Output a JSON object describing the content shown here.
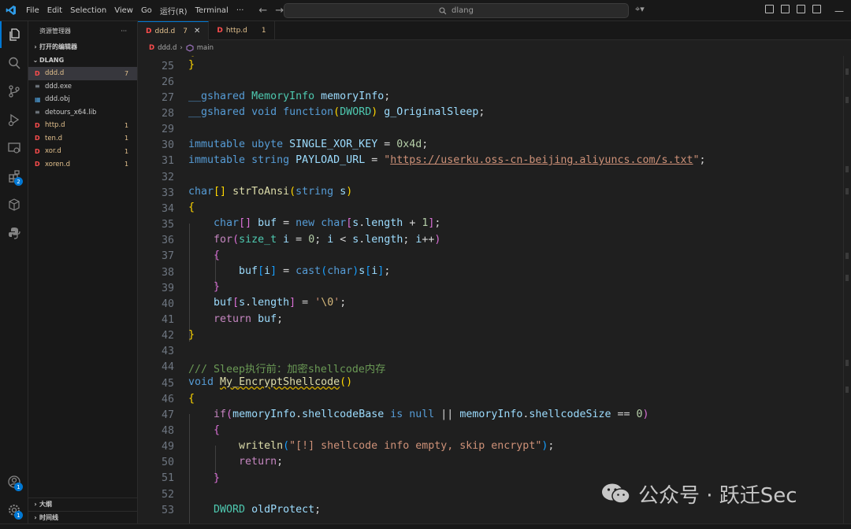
{
  "titlebar": {
    "menu": [
      "File",
      "Edit",
      "Selection",
      "View",
      "Go",
      "运行(R)",
      "Terminal",
      "···"
    ],
    "search_text": "dlang"
  },
  "activity_badges": {
    "extensions": "2",
    "accounts": "1",
    "settings": "1"
  },
  "sidebar": {
    "title": "资源管理器",
    "more": "···",
    "open_editors_label": "打开的编辑器",
    "folder_label": "DLANG",
    "files": [
      {
        "icon": "D",
        "name": "ddd.d",
        "count": "7",
        "modified": true,
        "selected": true
      },
      {
        "icon": "≡",
        "name": "ddd.exe",
        "count": "",
        "modified": false,
        "selected": false
      },
      {
        "icon": "▦",
        "name": "ddd.obj",
        "count": "",
        "modified": false,
        "selected": false
      },
      {
        "icon": "≡",
        "name": "detours_x64.lib",
        "count": "",
        "modified": false,
        "selected": false
      },
      {
        "icon": "D",
        "name": "http.d",
        "count": "1",
        "modified": true,
        "selected": false
      },
      {
        "icon": "D",
        "name": "ten.d",
        "count": "1",
        "modified": true,
        "selected": false
      },
      {
        "icon": "D",
        "name": "xor.d",
        "count": "1",
        "modified": true,
        "selected": false
      },
      {
        "icon": "D",
        "name": "xoren.d",
        "count": "1",
        "modified": true,
        "selected": false
      }
    ],
    "outline_label": "大纲",
    "timeline_label": "时间线"
  },
  "tabs": [
    {
      "icon": "D",
      "name": "ddd.d",
      "count": "7",
      "close": "✕",
      "active": true
    },
    {
      "icon": "D",
      "name": "http.d",
      "count": "1",
      "close": "",
      "active": false
    }
  ],
  "breadcrumb": {
    "file_icon": "D",
    "file": "ddd.d",
    "sep": "›",
    "symbol": "main"
  },
  "editor": {
    "line_numbers": [
      "25",
      "26",
      "27",
      "28",
      "29",
      "30",
      "31",
      "32",
      "33",
      "34",
      "35",
      "36",
      "37",
      "38",
      "39",
      "40",
      "41",
      "42",
      "43",
      "44",
      "45",
      "46",
      "47",
      "48",
      "49",
      "50",
      "51",
      "52",
      "53"
    ],
    "partial_top": "{"
  },
  "watermark": {
    "text": "公众号 · 跃迁Sec"
  },
  "colors": {
    "accent": "#0078d4",
    "modified": "#e2c08d",
    "dfile": "#ff4d4d"
  }
}
